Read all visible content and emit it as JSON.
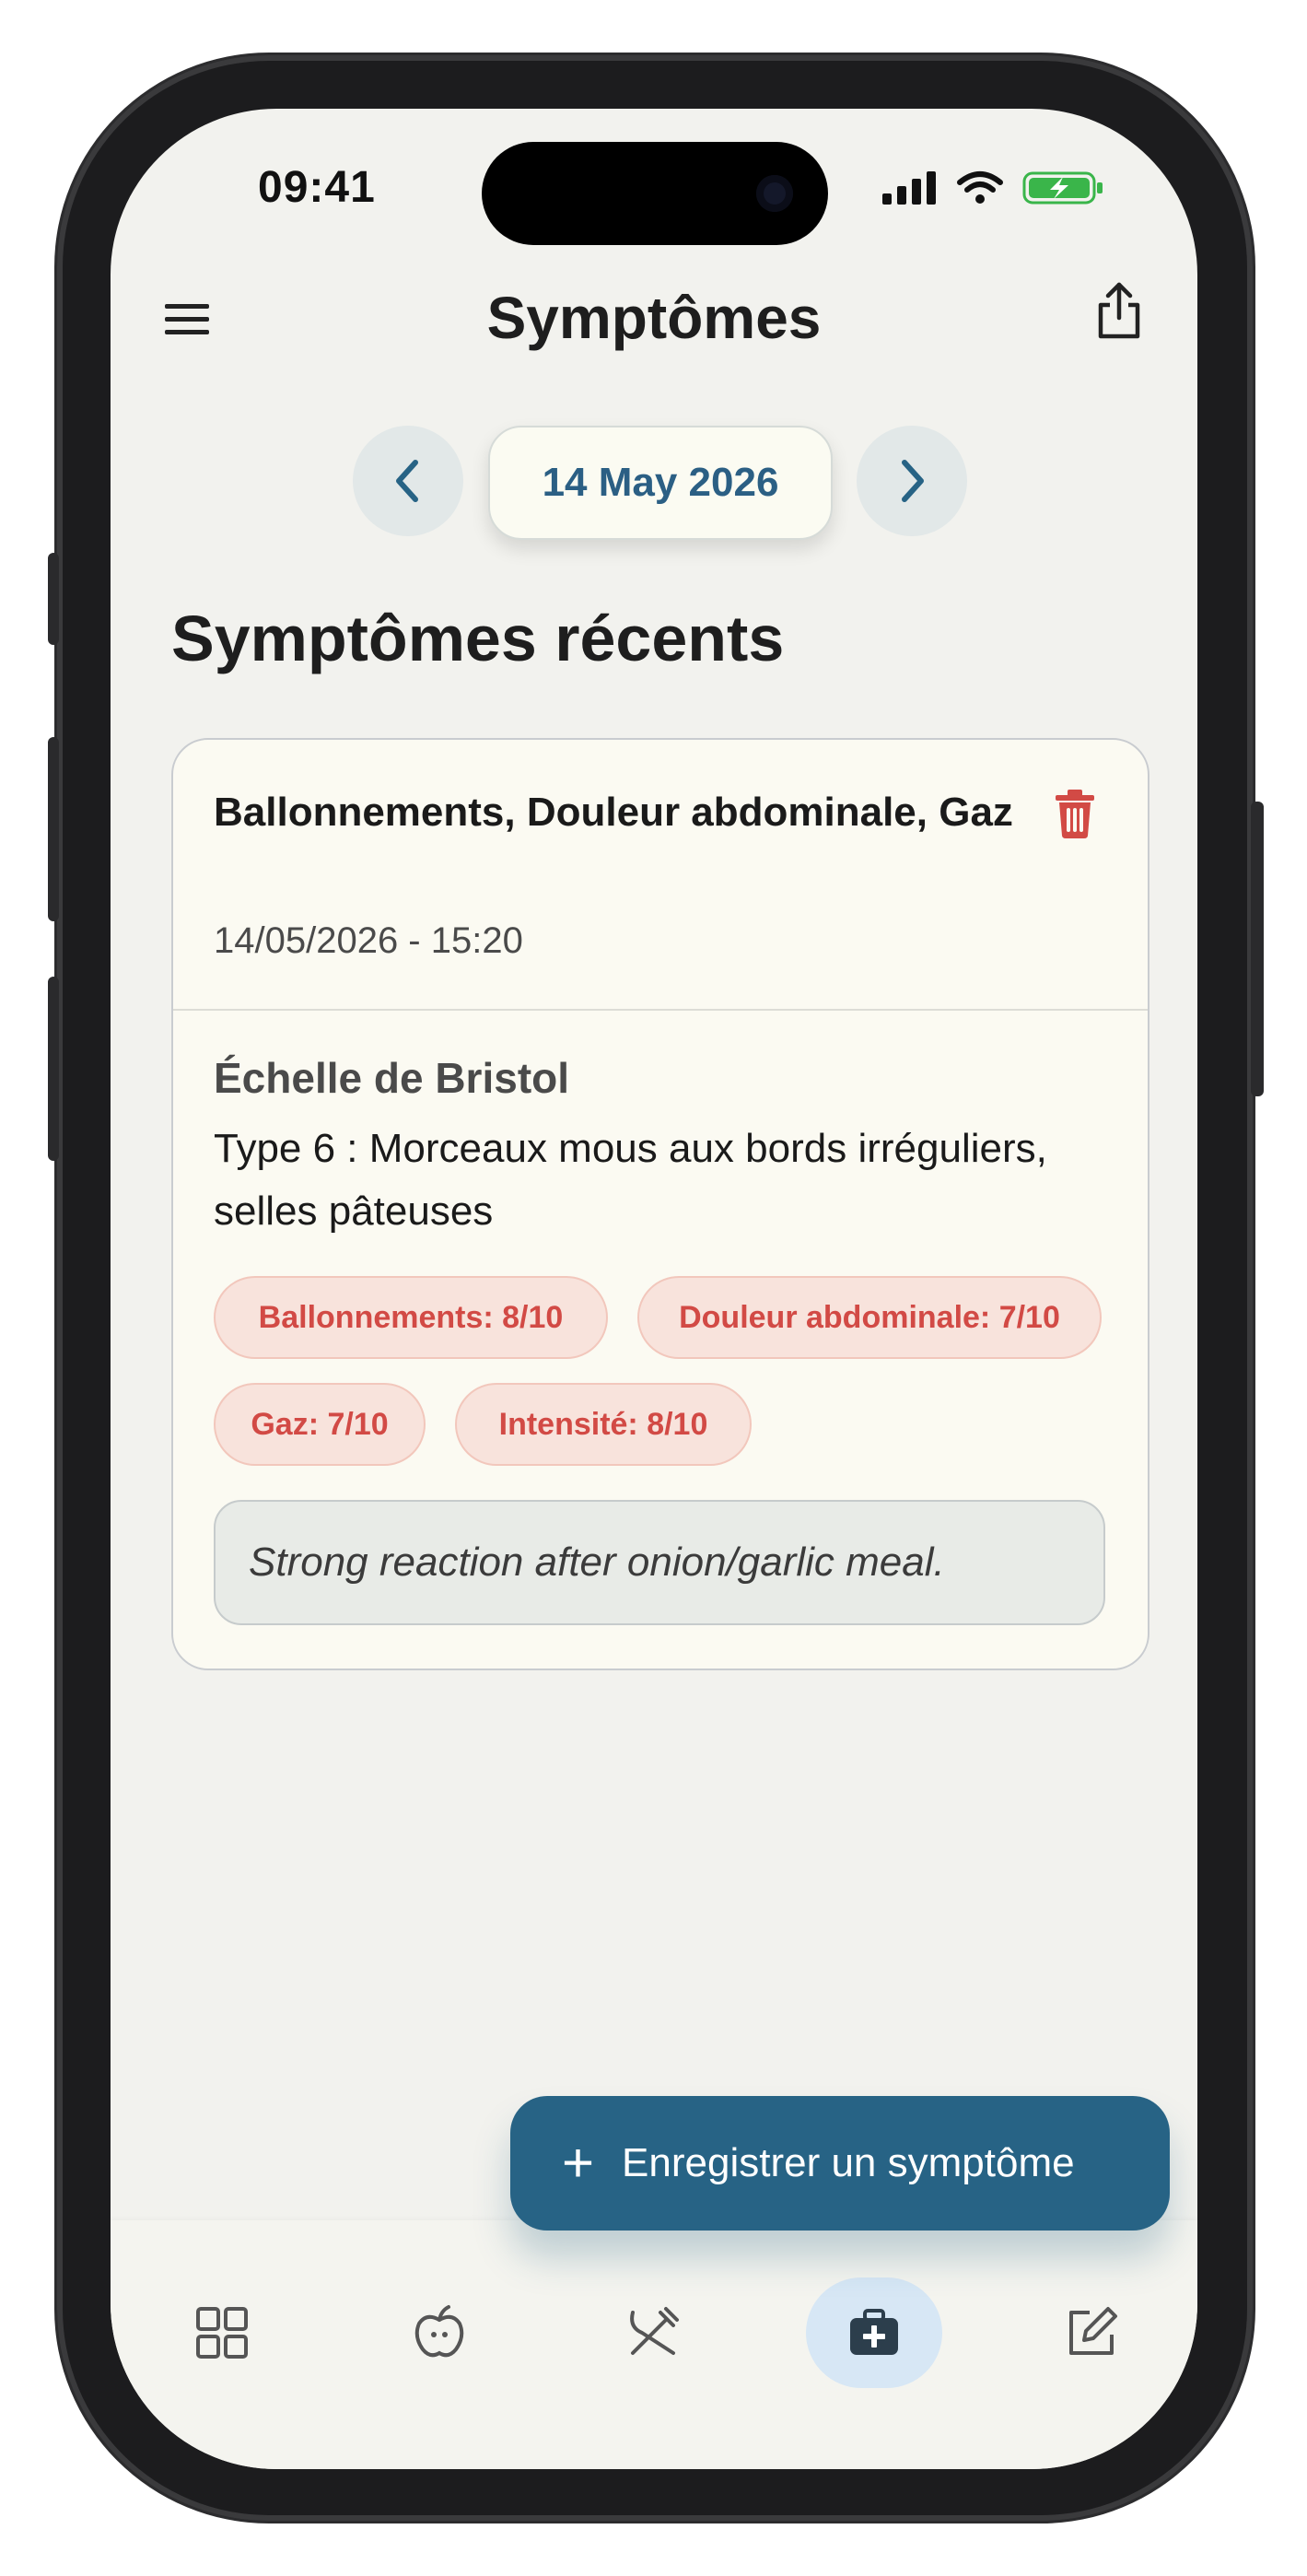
{
  "status_bar": {
    "time": "09:41"
  },
  "header": {
    "title": "Symptômes"
  },
  "date_nav": {
    "date": "14 May 2026"
  },
  "section": {
    "title": "Symptômes récents"
  },
  "entry": {
    "title": "Ballonnements, Douleur abdominale, Gaz",
    "datetime": "14/05/2026 - 15:20",
    "bristol_label": "Échelle de Bristol",
    "bristol_value": "Type 6 : Morceaux mous aux bords irréguliers, selles pâteuses",
    "tags": [
      "Ballonnements: 8/10",
      "Douleur abdominale: 7/10",
      "Gaz: 7/10",
      "Intensité: 8/10"
    ],
    "note": "Strong reaction after onion/garlic meal."
  },
  "fab": {
    "label": "Enregistrer un symptôme"
  },
  "bottom_nav": {
    "items": [
      "dashboard-icon",
      "apple-icon",
      "utensils-icon",
      "medical-kit-icon",
      "edit-icon"
    ],
    "active_index": 3
  },
  "colors": {
    "accent": "#276385",
    "tag_bg": "#f8e3dc",
    "tag_text": "#d24a45",
    "delete": "#d24a45"
  }
}
